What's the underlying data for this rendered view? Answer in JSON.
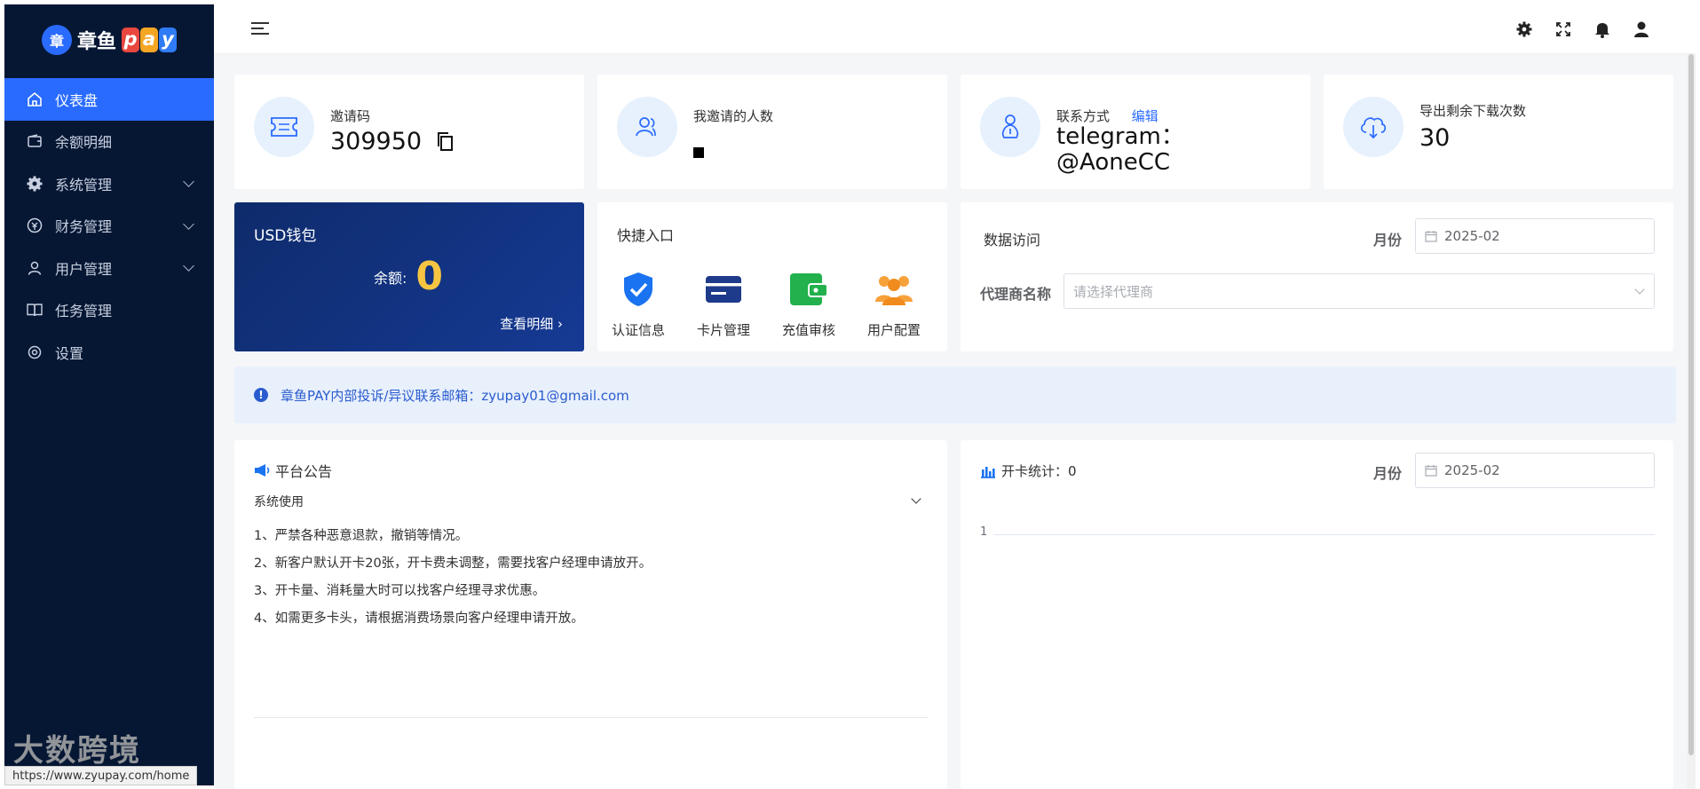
{
  "brand": {
    "logo_glyph": "章",
    "name": "章鱼",
    "pay_letters": [
      "p",
      "a",
      "y"
    ],
    "pay_colors": [
      "#e9473f",
      "#f5a623",
      "#2f7bf6"
    ]
  },
  "sidebar": {
    "items": [
      {
        "label": "仪表盘",
        "icon": "home-icon",
        "active": true
      },
      {
        "label": "余额明细",
        "icon": "wallet-icon"
      },
      {
        "label": "系统管理",
        "icon": "gear-icon",
        "expandable": true
      },
      {
        "label": "财务管理",
        "icon": "finance-icon",
        "expandable": true
      },
      {
        "label": "用户管理",
        "icon": "user-icon",
        "expandable": true
      },
      {
        "label": "任务管理",
        "icon": "book-icon"
      },
      {
        "label": "设置",
        "icon": "settings-icon"
      }
    ]
  },
  "status_url": "https://www.zyupay.com/home",
  "watermark": "大数跨境",
  "stats": [
    {
      "label": "邀请码",
      "value": "309950",
      "icon": "ticket-icon"
    },
    {
      "label": "我邀请的人数",
      "value": "",
      "icon": "users-icon"
    },
    {
      "label": "联系方式",
      "edit": "编辑",
      "value_line1": "telegram：",
      "value_line2": "@AoneCC",
      "icon": "contact-icon"
    },
    {
      "label": "导出剩余下载次数",
      "value": "30",
      "icon": "cloud-download-icon"
    }
  ],
  "wallet": {
    "title": "USD钱包",
    "balance_label": "余额:",
    "balance": "0",
    "details_link": "查看明细"
  },
  "quick": {
    "title": "快捷入口",
    "items": [
      "认证信息",
      "卡片管理",
      "充值审核",
      "用户配置"
    ]
  },
  "data_access": {
    "title": "数据访问",
    "month_label": "月份",
    "month_value": "2025-02",
    "agent_label": "代理商名称",
    "agent_placeholder": "请选择代理商"
  },
  "notice": {
    "text": "章鱼PAY内部投诉/异议联系邮箱：zyupay01@gmail.com"
  },
  "announcement": {
    "title": "平台公告",
    "section": "系统使用",
    "lines": [
      "1、严禁各种恶意退款，撤销等情况。",
      "2、新客户默认开卡20张，开卡费未调整，需要找客户经理申请放开。",
      "3、开卡量、消耗量大时可以找客户经理寻求优惠。",
      "4、如需更多卡头，请根据消费场景向客户经理申请开放。"
    ]
  },
  "card_stats": {
    "title": "开卡统计：0",
    "month_label": "月份",
    "month_value": "2025-02"
  },
  "chart_data": {
    "type": "line",
    "y_ticks": [
      "1"
    ],
    "series": []
  },
  "colors": {
    "accent": "#2a6bff",
    "sidebar_bg": "#061734",
    "wallet_amount": "#f5c542"
  }
}
